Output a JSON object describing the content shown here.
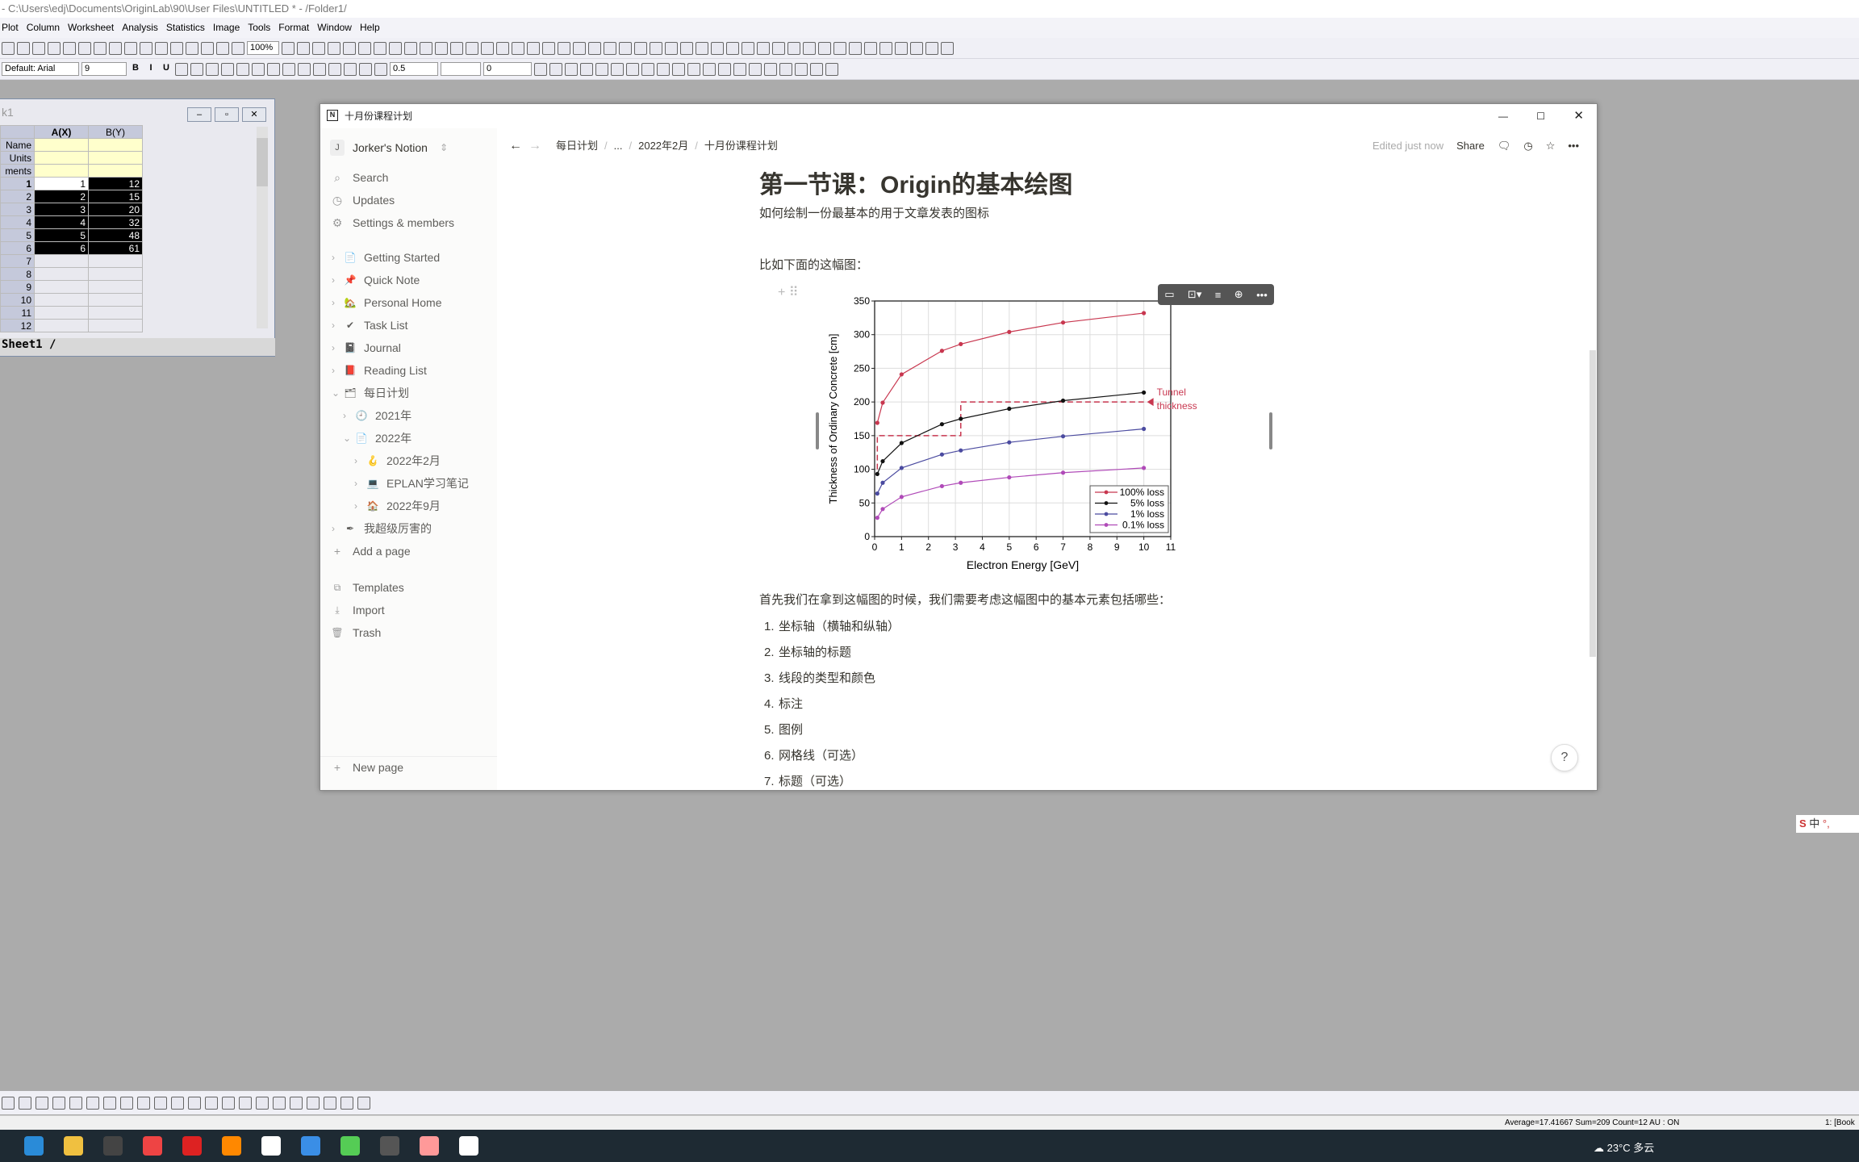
{
  "origin": {
    "title": "- C:\\Users\\edj\\Documents\\OriginLab\\90\\User Files\\UNTITLED * - /Folder1/",
    "menu": [
      "Plot",
      "Column",
      "Worksheet",
      "Analysis",
      "Statistics",
      "Image",
      "Tools",
      "Format",
      "Window",
      "Help"
    ],
    "zoom": "100%",
    "font": "Default: Arial",
    "font_size": "9",
    "line_width": "0.5",
    "pattern_value": "0",
    "worksheet": {
      "title": "k1",
      "columns": [
        "A(X)",
        "B(Y)"
      ],
      "meta_rows": [
        "Name",
        "Units",
        "ments"
      ],
      "rows": [
        [
          "1",
          "1",
          "12"
        ],
        [
          "2",
          "2",
          "15"
        ],
        [
          "3",
          "3",
          "20"
        ],
        [
          "4",
          "4",
          "32"
        ],
        [
          "5",
          "5",
          "48"
        ],
        [
          "6",
          "6",
          "61"
        ],
        [
          "7",
          "",
          ""
        ],
        [
          "8",
          "",
          ""
        ],
        [
          "9",
          "",
          ""
        ],
        [
          "10",
          "",
          ""
        ],
        [
          "11",
          "",
          ""
        ],
        [
          "12",
          "",
          ""
        ]
      ],
      "sheet_tab": "Sheet1"
    },
    "status": "Average=17.41667 Sum=209 Count=12  AU : ON",
    "status_right": "1: [Book"
  },
  "notion": {
    "window_title": "十月份课程计划",
    "workspace": {
      "initial": "J",
      "name": "Jorker's Notion"
    },
    "top_items": [
      {
        "icon": "search-icon",
        "label": "Search"
      },
      {
        "icon": "clock-icon",
        "label": "Updates"
      },
      {
        "icon": "gear-icon",
        "label": "Settings & members"
      }
    ],
    "pages": [
      {
        "label": "Getting Started",
        "icon": "📄",
        "depth": 0,
        "open": false
      },
      {
        "label": "Quick Note",
        "icon": "📌",
        "depth": 0,
        "open": false
      },
      {
        "label": "Personal Home",
        "icon": "🏡",
        "depth": 0,
        "open": false
      },
      {
        "label": "Task List",
        "icon": "✔",
        "depth": 0,
        "open": false
      },
      {
        "label": "Journal",
        "icon": "📓",
        "depth": 0,
        "open": false
      },
      {
        "label": "Reading List",
        "icon": "📕",
        "depth": 0,
        "open": false
      },
      {
        "label": "每日计划",
        "icon": "🗂",
        "depth": 0,
        "open": true
      },
      {
        "label": "2021年",
        "icon": "🕘",
        "depth": 1,
        "open": false
      },
      {
        "label": "2022年",
        "icon": "📄",
        "depth": 1,
        "open": true
      },
      {
        "label": "2022年2月",
        "icon": "🪝",
        "depth": 2,
        "open": false
      },
      {
        "label": "EPLAN学习笔记",
        "icon": "💻",
        "depth": 2,
        "open": false
      },
      {
        "label": "2022年9月",
        "icon": "🏠",
        "depth": 2,
        "open": false
      },
      {
        "label": "我超级厉害的",
        "icon": "✒",
        "depth": 0,
        "open": false
      }
    ],
    "add_page": "Add a page",
    "bottom_items": [
      {
        "icon": "templates-icon",
        "label": "Templates"
      },
      {
        "icon": "import-icon",
        "label": "Import"
      },
      {
        "icon": "trash-icon",
        "label": "Trash"
      }
    ],
    "new_page": "New page",
    "breadcrumb": [
      "每日计划",
      "...",
      "2022年2月",
      "十月份课程计划"
    ],
    "edited": "Edited just now",
    "share": "Share",
    "heading": "第一节课：Origin的基本绘图",
    "subtitle": "如何绘制一份最基本的用于文章发表的图标",
    "intro": "比如下面的这幅图：",
    "para": "首先我们在拿到这幅图的时候，我们需要考虑这幅图中的基本元素包括哪些：",
    "list": [
      "坐标轴（横轴和纵轴）",
      "坐标轴的标题",
      "线段的类型和颜色",
      "标注",
      "图例",
      "网格线（可选）",
      "标题（可选）"
    ],
    "help": "?"
  },
  "chart_data": {
    "type": "line",
    "xlabel": "Electron Energy [GeV]",
    "ylabel": "Thickness of Ordinary Concrete [cm]",
    "xlim": [
      0,
      11
    ],
    "ylim": [
      0,
      350
    ],
    "xticks": [
      "0",
      "1",
      "2",
      "3",
      "4",
      "5",
      "6",
      "7",
      "8",
      "9",
      "10",
      "11"
    ],
    "yticks": [
      "0",
      "50",
      "100",
      "150",
      "200",
      "250",
      "300",
      "350"
    ],
    "grid": true,
    "legend": "bottom-right",
    "x": [
      0.1,
      0.3,
      1,
      2.5,
      3.2,
      5,
      7,
      10
    ],
    "series": [
      {
        "name": "100% loss",
        "color": "#c8374f",
        "values": [
          169,
          199,
          241,
          276,
          286,
          304,
          318,
          332
        ]
      },
      {
        "name": "5% loss",
        "color": "#111111",
        "values": [
          93,
          112,
          139,
          167,
          175,
          190,
          202,
          214
        ]
      },
      {
        "name": "1% loss",
        "color": "#4b4ba0",
        "values": [
          64,
          80,
          102,
          122,
          128,
          140,
          149,
          160
        ]
      },
      {
        "name": "0.1% loss",
        "color": "#b04ab8",
        "values": [
          28,
          41,
          59,
          75,
          80,
          88,
          95,
          102
        ]
      }
    ],
    "annotation": {
      "text": [
        "Tunnel",
        "thickness"
      ],
      "color": "#c8374f",
      "path": [
        [
          0.1,
          100
        ],
        [
          0.1,
          150
        ],
        [
          3.2,
          150
        ],
        [
          3.2,
          200
        ],
        [
          10,
          200
        ]
      ]
    }
  },
  "taskbar": {
    "weather": "23°C 多云",
    "ime": "中"
  }
}
